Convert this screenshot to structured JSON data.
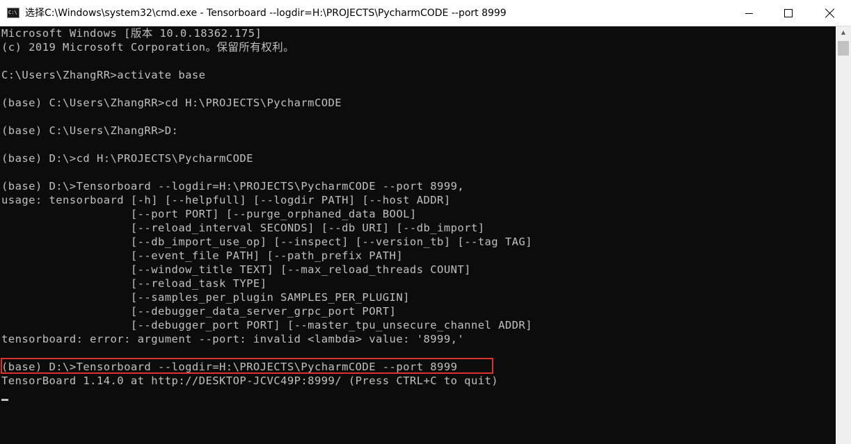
{
  "window": {
    "icon_text": "C:\\",
    "title": "选择C:\\Windows\\system32\\cmd.exe - Tensorboard  --logdir=H:\\PROJECTS\\PycharmCODE --port 8999",
    "colors": {
      "console_bg": "#0c0c0c",
      "console_fg": "#c0c0c0",
      "highlight_border": "#e03131"
    }
  },
  "controls": {
    "minimize_icon": "minimize-icon",
    "maximize_icon": "maximize-icon",
    "close_icon": "close-icon"
  },
  "console": {
    "lines": [
      "Microsoft Windows [版本 10.0.18362.175]",
      "(c) 2019 Microsoft Corporation。保留所有权利。",
      "",
      "C:\\Users\\ZhangRR>activate base",
      "",
      "(base) C:\\Users\\ZhangRR>cd H:\\PROJECTS\\PycharmCODE",
      "",
      "(base) C:\\Users\\ZhangRR>D:",
      "",
      "(base) D:\\>cd H:\\PROJECTS\\PycharmCODE",
      "",
      "(base) D:\\>Tensorboard --logdir=H:\\PROJECTS\\PycharmCODE --port 8999,",
      "usage: tensorboard [-h] [--helpfull] [--logdir PATH] [--host ADDR]",
      "                   [--port PORT] [--purge_orphaned_data BOOL]",
      "                   [--reload_interval SECONDS] [--db URI] [--db_import]",
      "                   [--db_import_use_op] [--inspect] [--version_tb] [--tag TAG]",
      "                   [--event_file PATH] [--path_prefix PATH]",
      "                   [--window_title TEXT] [--max_reload_threads COUNT]",
      "                   [--reload_task TYPE]",
      "                   [--samples_per_plugin SAMPLES_PER_PLUGIN]",
      "                   [--debugger_data_server_grpc_port PORT]",
      "                   [--debugger_port PORT] [--master_tpu_unsecure_channel ADDR]",
      "tensorboard: error: argument --port: invalid <lambda> value: '8999,'",
      "",
      "(base) D:\\>Tensorboard --logdir=H:\\PROJECTS\\PycharmCODE --port 8999",
      "TensorBoard 1.14.0 at http://DESKTOP-JCVC49P:8999/ (Press CTRL+C to quit)"
    ]
  }
}
